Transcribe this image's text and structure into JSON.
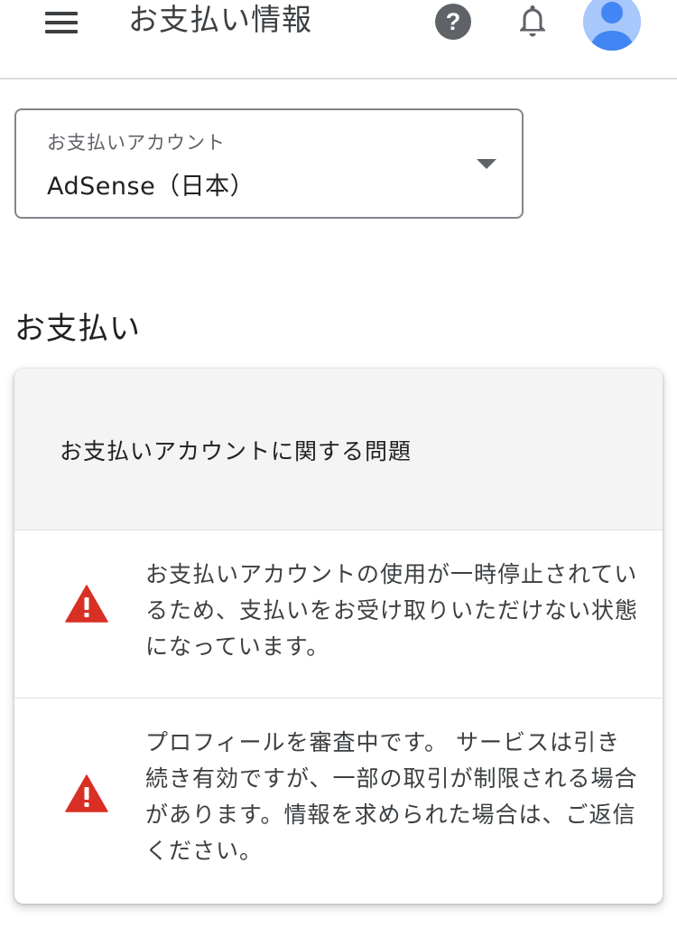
{
  "header": {
    "title": "お支払い情報",
    "menu_icon": "hamburger-menu-icon",
    "help_icon": "help-circle-icon",
    "notification_icon": "bell-icon",
    "avatar_icon": "person-avatar-icon"
  },
  "account": {
    "label": "お支払いアカウント",
    "value": "AdSense（日本）"
  },
  "section": {
    "title": "お支払い"
  },
  "card": {
    "header": "お支払いアカウントに関する問題",
    "issues": [
      {
        "icon": "warning-triangle-icon",
        "text": "お支払いアカウントの使用が一時停止されているため、支払いをお受け取りいただけない状態になっています。"
      },
      {
        "icon": "warning-triangle-icon",
        "text": "プロフィールを審査中です。 サービスは引き続き有効ですが、一部の取引が制限される場合があります。情報を求められた場合は、ご返信ください。"
      }
    ]
  },
  "colors": {
    "warning": "#d93025",
    "avatar_bg": "#a8c7fa",
    "avatar_fg": "#4285f4",
    "card_header_bg": "#f4f4f4"
  }
}
